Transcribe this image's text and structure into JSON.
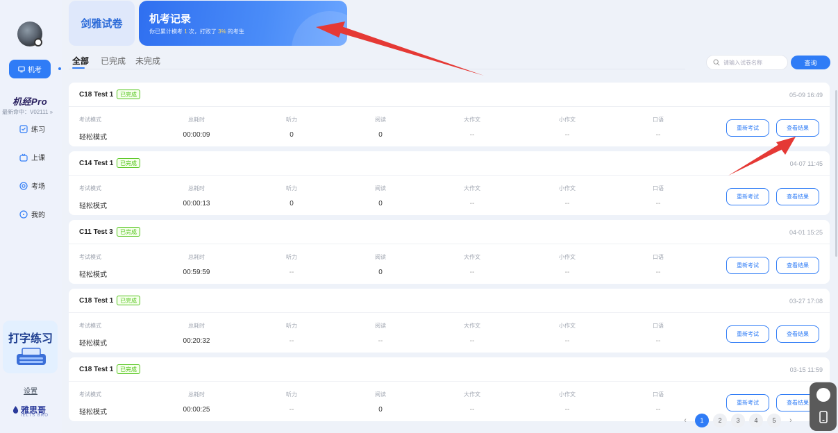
{
  "sidebar": {
    "active_nav": "机考",
    "pro_label": "机经Pro",
    "version": "最新命中：V02111 »",
    "items": [
      {
        "label": "练习",
        "icon": "practice-icon"
      },
      {
        "label": "上课",
        "icon": "class-icon"
      },
      {
        "label": "考场",
        "icon": "exam-room-icon"
      },
      {
        "label": "我的",
        "icon": "profile-icon"
      }
    ],
    "typing_card": "打字练习",
    "settings": "设置",
    "brand": "雅思哥",
    "brand_sub": "IELTS BRO"
  },
  "tabs": {
    "inactive": "剑雅试卷",
    "active_title": "机考记录",
    "active_sub_prefix": "你已累计模考 ",
    "active_sub_count": "1",
    "active_sub_middle": " 次，打败了 ",
    "active_sub_percent": "3%",
    "active_sub_suffix": " 的考生"
  },
  "filters": [
    "全部",
    "已完成",
    "未完成"
  ],
  "search": {
    "placeholder": "请输入试卷名称",
    "button": "查询"
  },
  "columns": [
    "考试模式",
    "总耗时",
    "听力",
    "阅读",
    "大作文",
    "小作文",
    "口语"
  ],
  "buttons": {
    "retake": "重新考试",
    "view": "查看结果"
  },
  "records": [
    {
      "title": "C18 Test 1",
      "status": "已完成",
      "time": "05-09 16:49",
      "values": [
        "轻松模式",
        "00:00:09",
        "0",
        "0",
        "--",
        "--",
        "--"
      ]
    },
    {
      "title": "C14 Test 1",
      "status": "已完成",
      "time": "04-07 11:45",
      "values": [
        "轻松模式",
        "00:00:13",
        "0",
        "0",
        "--",
        "--",
        "--"
      ]
    },
    {
      "title": "C11 Test 3",
      "status": "已完成",
      "time": "04-01 15:25",
      "values": [
        "轻松模式",
        "00:59:59",
        "--",
        "0",
        "--",
        "--",
        "--"
      ]
    },
    {
      "title": "C18 Test 1",
      "status": "已完成",
      "time": "03-27 17:08",
      "values": [
        "轻松模式",
        "00:20:32",
        "--",
        "--",
        "--",
        "--",
        "--"
      ]
    },
    {
      "title": "C18 Test 1",
      "status": "已完成",
      "time": "03-15 11:59",
      "values": [
        "轻松模式",
        "00:00:25",
        "--",
        "0",
        "--",
        "--",
        "--"
      ]
    }
  ],
  "pagination": {
    "pages": [
      "1",
      "2",
      "3",
      "4",
      "5"
    ],
    "current": "1",
    "prev": "‹",
    "next": "›"
  },
  "colors": {
    "accent": "#2f7cf6",
    "success": "#52c41a",
    "annotation": "#e53935"
  }
}
